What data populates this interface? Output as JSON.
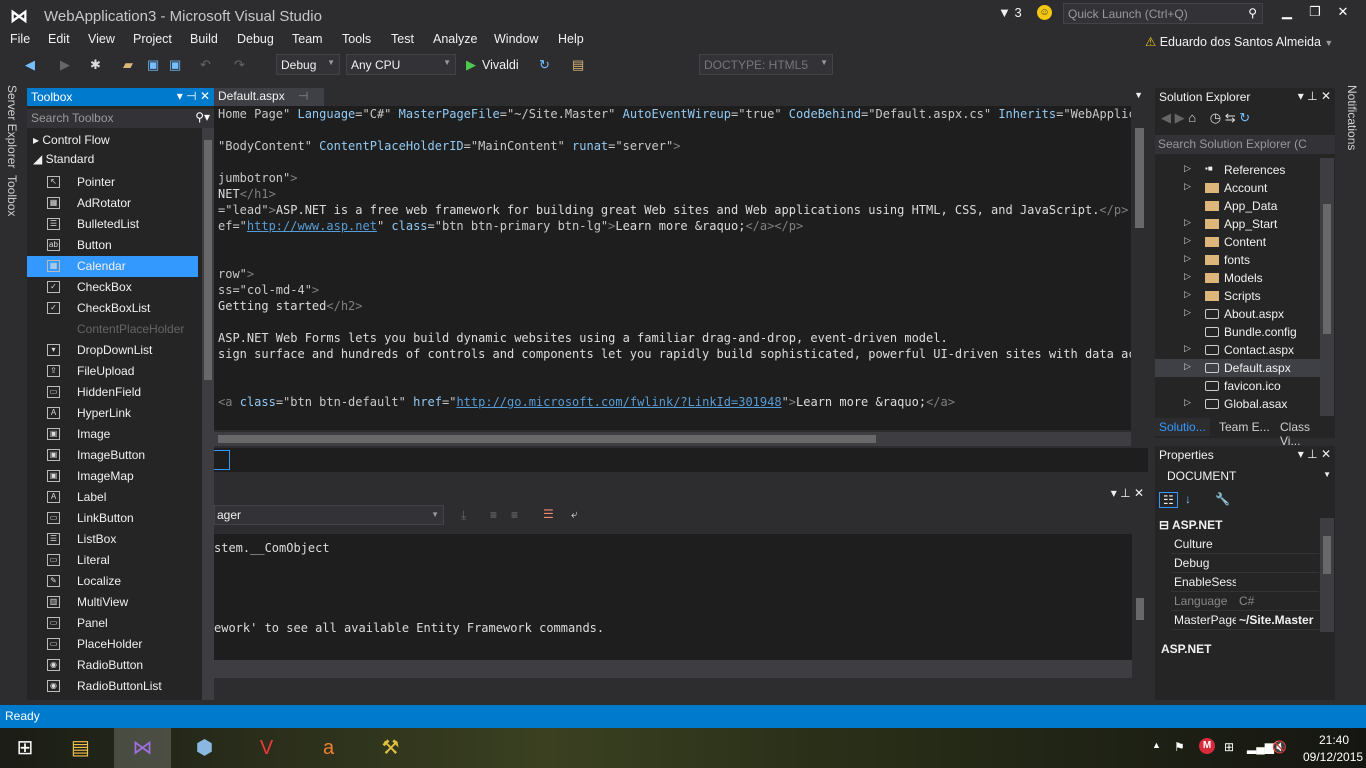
{
  "window": {
    "title": "WebApplication3 - Microsoft Visual Studio",
    "filter_count": "3",
    "quick_launch_placeholder": "Quick Launch (Ctrl+Q)",
    "user": "Eduardo dos Santos Almeida"
  },
  "menu": [
    "File",
    "Edit",
    "View",
    "Project",
    "Build",
    "Debug",
    "Team",
    "Tools",
    "Test",
    "Analyze",
    "Window",
    "Help"
  ],
  "toolbar": {
    "config": "Debug",
    "platform": "Any CPU",
    "run_target": "Vivaldi",
    "doctype": "DOCTYPE: HTML5"
  },
  "side_tabs": {
    "server_explorer": "Server Explorer",
    "toolbox": "Toolbox",
    "notifications": "Notifications"
  },
  "toolbox": {
    "title": "Toolbox",
    "search_placeholder": "Search Toolbox",
    "groups": [
      "Control Flow",
      "Standard"
    ],
    "items": [
      {
        "label": "Pointer",
        "icon": "pointer"
      },
      {
        "label": "AdRotator",
        "icon": "adrotator"
      },
      {
        "label": "BulletedList",
        "icon": "list"
      },
      {
        "label": "Button",
        "icon": "button"
      },
      {
        "label": "Calendar",
        "icon": "calendar",
        "selected": true
      },
      {
        "label": "CheckBox",
        "icon": "checkbox"
      },
      {
        "label": "CheckBoxList",
        "icon": "checkboxlist"
      },
      {
        "label": "ContentPlaceHolder",
        "icon": "none",
        "disabled": true
      },
      {
        "label": "DropDownList",
        "icon": "dropdown"
      },
      {
        "label": "FileUpload",
        "icon": "upload"
      },
      {
        "label": "HiddenField",
        "icon": "hidden"
      },
      {
        "label": "HyperLink",
        "icon": "hyperlink"
      },
      {
        "label": "Image",
        "icon": "image"
      },
      {
        "label": "ImageButton",
        "icon": "imagebutton"
      },
      {
        "label": "ImageMap",
        "icon": "imagemap"
      },
      {
        "label": "Label",
        "icon": "label"
      },
      {
        "label": "LinkButton",
        "icon": "linkbutton"
      },
      {
        "label": "ListBox",
        "icon": "listbox"
      },
      {
        "label": "Literal",
        "icon": "literal"
      },
      {
        "label": "Localize",
        "icon": "localize"
      },
      {
        "label": "MultiView",
        "icon": "multiview"
      },
      {
        "label": "Panel",
        "icon": "panel"
      },
      {
        "label": "PlaceHolder",
        "icon": "placeholder"
      },
      {
        "label": "RadioButton",
        "icon": "radio"
      },
      {
        "label": "RadioButtonList",
        "icon": "radiolist"
      }
    ]
  },
  "editor": {
    "tab": "Default.aspx",
    "lines": [
      [
        {
          "t": "Home Page\" ",
          "c": "val"
        },
        {
          "t": "Language",
          "c": "attr"
        },
        {
          "t": "=\"C#\" ",
          "c": "val"
        },
        {
          "t": "MasterPageFile",
          "c": "attr"
        },
        {
          "t": "=\"~/Site.Master\" ",
          "c": "val"
        },
        {
          "t": "AutoEventWireup",
          "c": "attr"
        },
        {
          "t": "=\"true\" ",
          "c": "val"
        },
        {
          "t": "CodeBehind",
          "c": "attr"
        },
        {
          "t": "=\"Default.aspx.cs\" ",
          "c": "val"
        },
        {
          "t": "Inherits",
          "c": "attr"
        },
        {
          "t": "=\"WebApplicatio",
          "c": "val"
        }
      ],
      [],
      [
        {
          "t": "\"BodyContent\" ",
          "c": "val"
        },
        {
          "t": "ContentPlaceHolderID",
          "c": "attr"
        },
        {
          "t": "=\"MainContent\" ",
          "c": "val"
        },
        {
          "t": "runat",
          "c": "attr"
        },
        {
          "t": "=\"server\"",
          "c": "val"
        },
        {
          "t": ">",
          "c": "tag"
        }
      ],
      [],
      [
        {
          "t": "jumbotron\"",
          "c": "val"
        },
        {
          "t": ">",
          "c": "tag"
        }
      ],
      [
        {
          "t": "NET",
          "c": "text"
        },
        {
          "t": "</h1>",
          "c": "tag"
        }
      ],
      [
        {
          "t": "=\"lead\"",
          "c": "val"
        },
        {
          "t": ">",
          "c": "tag"
        },
        {
          "t": "ASP.NET is a free web framework for building great Web sites and Web applications using HTML, CSS, and JavaScript.",
          "c": "text"
        },
        {
          "t": "</p>",
          "c": "tag"
        }
      ],
      [
        {
          "t": "ef=\"",
          "c": "val"
        },
        {
          "t": "http://www.asp.net",
          "c": "link"
        },
        {
          "t": "\" ",
          "c": "val"
        },
        {
          "t": "class",
          "c": "attr"
        },
        {
          "t": "=\"btn btn-primary btn-lg\"",
          "c": "val"
        },
        {
          "t": ">",
          "c": "tag"
        },
        {
          "t": "Learn more &raquo;",
          "c": "text"
        },
        {
          "t": "</a></p>",
          "c": "tag"
        }
      ],
      [],
      [],
      [
        {
          "t": "row\"",
          "c": "val"
        },
        {
          "t": ">",
          "c": "tag"
        }
      ],
      [
        {
          "t": "ss=\"col-md-4\"",
          "c": "val"
        },
        {
          "t": ">",
          "c": "tag"
        }
      ],
      [
        {
          "t": "Getting started",
          "c": "text"
        },
        {
          "t": "</h2>",
          "c": "tag"
        }
      ],
      [],
      [
        {
          "t": "ASP.NET Web Forms lets you build dynamic websites using a familiar drag-and-drop, event-driven model.",
          "c": "text"
        }
      ],
      [
        {
          "t": "sign surface and hundreds of controls and components let you rapidly build sophisticated, powerful UI-driven sites with data access.",
          "c": "text"
        }
      ],
      [],
      [],
      [
        {
          "t": "<a ",
          "c": "tag"
        },
        {
          "t": "class",
          "c": "attr"
        },
        {
          "t": "=\"btn btn-default\" ",
          "c": "val"
        },
        {
          "t": "href",
          "c": "attr"
        },
        {
          "t": "=\"",
          "c": "val"
        },
        {
          "t": "http://go.microsoft.com/fwlink/?LinkId=301948",
          "c": "link"
        },
        {
          "t": "\"",
          "c": "val"
        },
        {
          "t": ">",
          "c": "tag"
        },
        {
          "t": "Learn more &raquo;",
          "c": "text"
        },
        {
          "t": "</a>",
          "c": "tag"
        }
      ]
    ]
  },
  "output": {
    "source": "ager",
    "lines": [
      "stem.__ComObject",
      "",
      "",
      "",
      "",
      "ework' to see all available Entity Framework commands."
    ]
  },
  "solution_explorer": {
    "title": "Solution Explorer",
    "search_placeholder": "Search Solution Explorer (C",
    "items": [
      {
        "label": "References",
        "type": "references",
        "expandable": true
      },
      {
        "label": "Account",
        "type": "folder",
        "expandable": true
      },
      {
        "label": "App_Data",
        "type": "folder"
      },
      {
        "label": "App_Start",
        "type": "folder",
        "expandable": true
      },
      {
        "label": "Content",
        "type": "folder",
        "expandable": true
      },
      {
        "label": "fonts",
        "type": "folder",
        "expandable": true
      },
      {
        "label": "Models",
        "type": "folder",
        "expandable": true
      },
      {
        "label": "Scripts",
        "type": "folder",
        "expandable": true
      },
      {
        "label": "About.aspx",
        "type": "file",
        "expandable": true
      },
      {
        "label": "Bundle.config",
        "type": "file"
      },
      {
        "label": "Contact.aspx",
        "type": "file",
        "expandable": true
      },
      {
        "label": "Default.aspx",
        "type": "file",
        "expandable": true,
        "selected": true
      },
      {
        "label": "favicon.ico",
        "type": "file"
      },
      {
        "label": "Global.asax",
        "type": "file",
        "expandable": true
      }
    ],
    "tabs": [
      "Solutio...",
      "Team E...",
      "Class Vi..."
    ]
  },
  "properties": {
    "title": "Properties",
    "object": "DOCUMENT",
    "category": "ASP.NET",
    "rows": [
      {
        "name": "Culture",
        "value": ""
      },
      {
        "name": "Debug",
        "value": ""
      },
      {
        "name": "EnableSessi",
        "value": ""
      },
      {
        "name": "Language",
        "value": "C#",
        "disabled": true
      },
      {
        "name": "MasterPage",
        "value": "~/Site.Master"
      }
    ],
    "description_title": "ASP.NET"
  },
  "status": {
    "text": "Ready"
  },
  "taskbar": {
    "apps": [
      "file-explorer",
      "visual-studio",
      "virtualbox",
      "vivaldi",
      "app-a",
      "tools"
    ],
    "time": "21:40",
    "date": "09/12/2015"
  },
  "colors": {
    "accent": "#007acc",
    "selection": "#3399ff",
    "editor_bg": "#1e1e1e",
    "chrome_bg": "#2d2d30"
  }
}
